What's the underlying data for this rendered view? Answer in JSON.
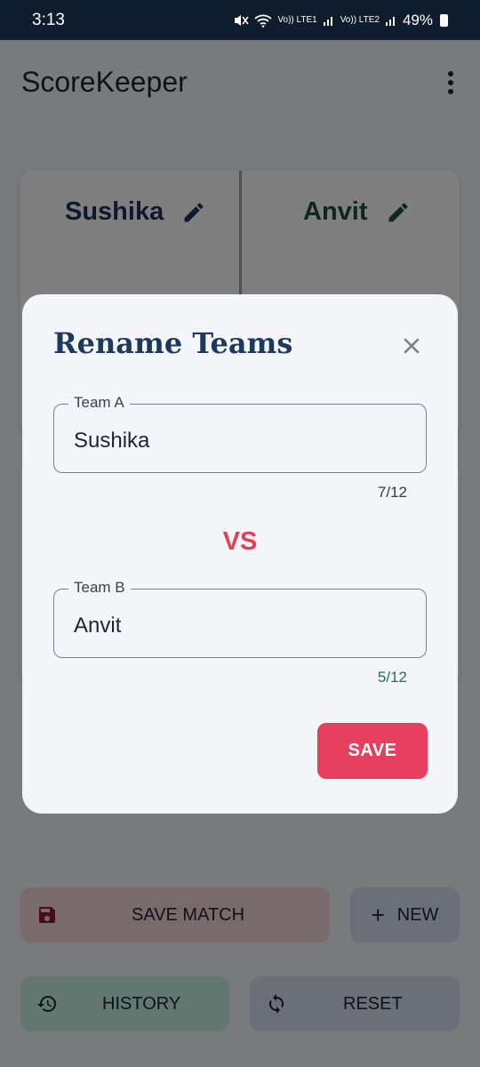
{
  "status_bar": {
    "time": "3:13",
    "network_1": "Vo)) LTE1",
    "network_2": "Vo)) LTE2",
    "battery": "49%"
  },
  "app_bar": {
    "title": "ScoreKeeper"
  },
  "teams": {
    "team_a": "Sushika",
    "team_b": "Anvit"
  },
  "actions": {
    "save_match": "SAVE MATCH",
    "new": "NEW",
    "history": "HISTORY",
    "reset": "RESET"
  },
  "dialog": {
    "title": "Rename Teams",
    "field_a": {
      "label": "Team A",
      "value": "Sushika",
      "counter": "7/12"
    },
    "vs": "VS",
    "field_b": {
      "label": "Team B",
      "value": "Anvit",
      "counter": "5/12"
    },
    "save": "SAVE"
  },
  "colors": {
    "accent": "#e6405e",
    "team_a": "#1d3557",
    "team_b": "#1e4e3f"
  }
}
